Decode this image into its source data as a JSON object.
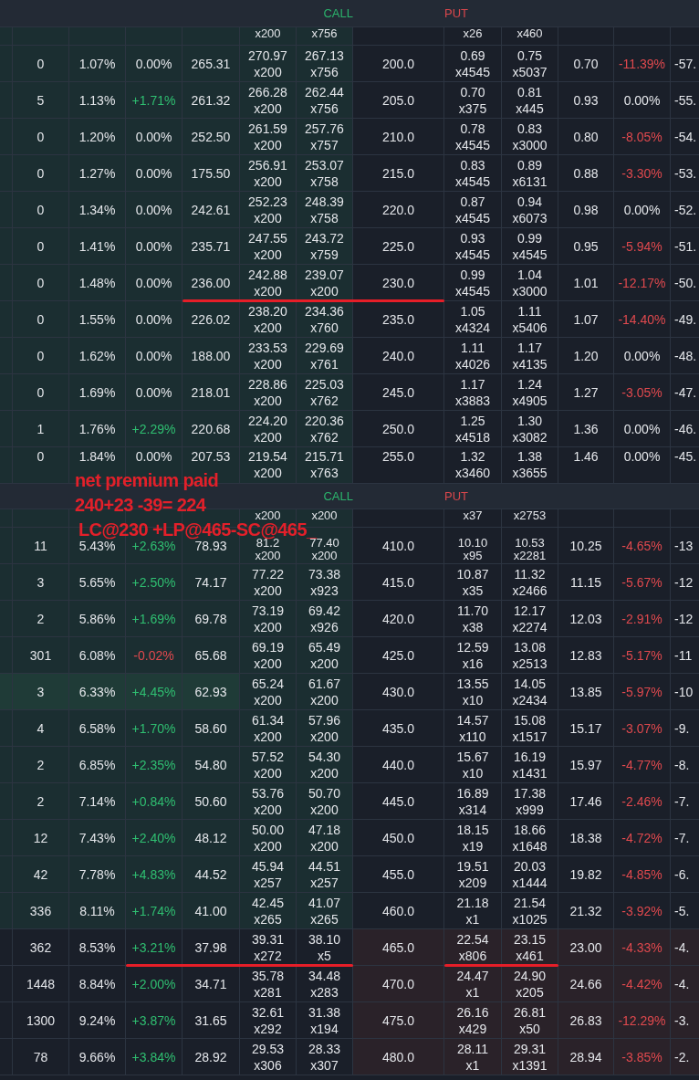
{
  "panels": [
    {
      "header": {
        "call": "CALL",
        "put": "PUT"
      },
      "rows": [
        {
          "kind": "cut",
          "highlighted": false,
          "call_itm": true,
          "put_itm": false,
          "call_quotes": [
            [
              "x200"
            ],
            [
              "x756"
            ]
          ],
          "put_quotes": [
            [
              "x26"
            ],
            [
              "x460"
            ]
          ]
        },
        {
          "kind": "full",
          "strike": "200.0",
          "highlighted": false,
          "call_itm": true,
          "put_itm": false,
          "call_cells": [
            "0",
            "1.07%",
            "265.31"
          ],
          "call_change": {
            "text": "0.00%",
            "color": "#e4e6ea"
          },
          "call_quotes": [
            [
              "270.97",
              "x200"
            ],
            [
              "267.13",
              "x756"
            ]
          ],
          "put_quotes": [
            [
              "0.69",
              "x4545"
            ],
            [
              "0.75",
              "x5037"
            ]
          ],
          "put_change": {
            "text": "-11.39%",
            "color": "#e0494e"
          },
          "put_cells": [
            "0.70",
            "-57."
          ]
        },
        {
          "kind": "full",
          "strike": "205.0",
          "highlighted": false,
          "call_itm": true,
          "put_itm": false,
          "call_cells": [
            "5",
            "1.13%",
            "261.32"
          ],
          "call_change": {
            "text": "+1.71%",
            "color": "#2fbf71"
          },
          "call_quotes": [
            [
              "266.28",
              "x200"
            ],
            [
              "262.44",
              "x756"
            ]
          ],
          "put_quotes": [
            [
              "0.70",
              "x375"
            ],
            [
              "0.81",
              "x445"
            ]
          ],
          "put_change": {
            "text": "0.00%",
            "color": "#e4e6ea"
          },
          "put_cells": [
            "0.93",
            "-55."
          ]
        },
        {
          "kind": "full",
          "strike": "210.0",
          "highlighted": false,
          "call_itm": true,
          "put_itm": false,
          "call_cells": [
            "0",
            "1.20%",
            "252.50"
          ],
          "call_change": {
            "text": "0.00%",
            "color": "#e4e6ea"
          },
          "call_quotes": [
            [
              "261.59",
              "x200"
            ],
            [
              "257.76",
              "x757"
            ]
          ],
          "put_quotes": [
            [
              "0.78",
              "x4545"
            ],
            [
              "0.83",
              "x3000"
            ]
          ],
          "put_change": {
            "text": "-8.05%",
            "color": "#e0494e"
          },
          "put_cells": [
            "0.80",
            "-54."
          ]
        },
        {
          "kind": "full",
          "strike": "215.0",
          "highlighted": false,
          "call_itm": true,
          "put_itm": false,
          "call_cells": [
            "0",
            "1.27%",
            "175.50"
          ],
          "call_change": {
            "text": "0.00%",
            "color": "#e4e6ea"
          },
          "call_quotes": [
            [
              "256.91",
              "x200"
            ],
            [
              "253.07",
              "x758"
            ]
          ],
          "put_quotes": [
            [
              "0.83",
              "x4545"
            ],
            [
              "0.89",
              "x6131"
            ]
          ],
          "put_change": {
            "text": "-3.30%",
            "color": "#e0494e"
          },
          "put_cells": [
            "0.88",
            "-53."
          ]
        },
        {
          "kind": "full",
          "strike": "220.0",
          "highlighted": false,
          "call_itm": true,
          "put_itm": false,
          "call_cells": [
            "0",
            "1.34%",
            "242.61"
          ],
          "call_change": {
            "text": "0.00%",
            "color": "#e4e6ea"
          },
          "call_quotes": [
            [
              "252.23",
              "x200"
            ],
            [
              "248.39",
              "x758"
            ]
          ],
          "put_quotes": [
            [
              "0.87",
              "x4545"
            ],
            [
              "0.94",
              "x6073"
            ]
          ],
          "put_change": {
            "text": "0.00%",
            "color": "#e4e6ea"
          },
          "put_cells": [
            "0.98",
            "-52."
          ]
        },
        {
          "kind": "full",
          "strike": "225.0",
          "highlighted": false,
          "call_itm": true,
          "put_itm": false,
          "call_cells": [
            "0",
            "1.41%",
            "235.71"
          ],
          "call_change": {
            "text": "0.00%",
            "color": "#e4e6ea"
          },
          "call_quotes": [
            [
              "247.55",
              "x200"
            ],
            [
              "243.72",
              "x759"
            ]
          ],
          "put_quotes": [
            [
              "0.93",
              "x4545"
            ],
            [
              "0.99",
              "x4545"
            ]
          ],
          "put_change": {
            "text": "-5.94%",
            "color": "#e0494e"
          },
          "put_cells": [
            "0.95",
            "-51."
          ]
        },
        {
          "kind": "full",
          "strike": "230.0",
          "highlighted": false,
          "call_itm": true,
          "put_itm": false,
          "call_cells": [
            "0",
            "1.48%",
            "236.00"
          ],
          "call_change": {
            "text": "0.00%",
            "color": "#e4e6ea"
          },
          "call_quotes": [
            [
              "242.88",
              "x200"
            ],
            [
              "239.07",
              "x200"
            ]
          ],
          "put_quotes": [
            [
              "0.99",
              "x4545"
            ],
            [
              "1.04",
              "x3000"
            ]
          ],
          "put_change": {
            "text": "-12.17%",
            "color": "#e0494e"
          },
          "put_cells": [
            "1.01",
            "-50."
          ],
          "underline_call": true,
          "underline_change": false,
          "underline_strike": true,
          "underline_put": false
        },
        {
          "kind": "full",
          "strike": "235.0",
          "highlighted": false,
          "call_itm": true,
          "put_itm": false,
          "call_cells": [
            "0",
            "1.55%",
            "226.02"
          ],
          "call_change": {
            "text": "0.00%",
            "color": "#e4e6ea"
          },
          "call_quotes": [
            [
              "238.20",
              "x200"
            ],
            [
              "234.36",
              "x760"
            ]
          ],
          "put_quotes": [
            [
              "1.05",
              "x4324"
            ],
            [
              "1.11",
              "x5406"
            ]
          ],
          "put_change": {
            "text": "-14.40%",
            "color": "#e0494e"
          },
          "put_cells": [
            "1.07",
            "-49."
          ]
        },
        {
          "kind": "full",
          "strike": "240.0",
          "highlighted": false,
          "call_itm": true,
          "put_itm": false,
          "call_cells": [
            "0",
            "1.62%",
            "188.00"
          ],
          "call_change": {
            "text": "0.00%",
            "color": "#e4e6ea"
          },
          "call_quotes": [
            [
              "233.53",
              "x200"
            ],
            [
              "229.69",
              "x761"
            ]
          ],
          "put_quotes": [
            [
              "1.11",
              "x4026"
            ],
            [
              "1.17",
              "x4135"
            ]
          ],
          "put_change": {
            "text": "0.00%",
            "color": "#e4e6ea"
          },
          "put_cells": [
            "1.20",
            "-48."
          ]
        },
        {
          "kind": "full",
          "strike": "245.0",
          "highlighted": false,
          "call_itm": true,
          "put_itm": false,
          "call_cells": [
            "0",
            "1.69%",
            "218.01"
          ],
          "call_change": {
            "text": "0.00%",
            "color": "#e4e6ea"
          },
          "call_quotes": [
            [
              "228.86",
              "x200"
            ],
            [
              "225.03",
              "x762"
            ]
          ],
          "put_quotes": [
            [
              "1.17",
              "x3883"
            ],
            [
              "1.24",
              "x4905"
            ]
          ],
          "put_change": {
            "text": "-3.05%",
            "color": "#e0494e"
          },
          "put_cells": [
            "1.27",
            "-47."
          ]
        },
        {
          "kind": "full",
          "strike": "250.0",
          "highlighted": false,
          "call_itm": true,
          "put_itm": false,
          "call_cells": [
            "1",
            "1.76%",
            "220.68"
          ],
          "call_change": {
            "text": "+2.29%",
            "color": "#2fbf71"
          },
          "call_quotes": [
            [
              "224.20",
              "x200"
            ],
            [
              "220.36",
              "x762"
            ]
          ],
          "put_quotes": [
            [
              "1.25",
              "x4518"
            ],
            [
              "1.30",
              "x3082"
            ]
          ],
          "put_change": {
            "text": "0.00%",
            "color": "#e4e6ea"
          },
          "put_cells": [
            "1.36",
            "-46."
          ]
        },
        {
          "kind": "full",
          "strike": "255.0",
          "highlighted": false,
          "call_itm": true,
          "put_itm": false,
          "call_cells": [
            "0",
            "1.84%",
            "207.53"
          ],
          "call_change": {
            "text": "0.00%",
            "color": "#e4e6ea"
          },
          "call_quotes": [
            [
              "219.54",
              "x200"
            ],
            [
              "215.71",
              "x763"
            ]
          ],
          "put_quotes": [
            [
              "1.32",
              "x3460"
            ],
            [
              "1.38",
              "x3655"
            ]
          ],
          "put_change": {
            "text": "0.00%",
            "color": "#e4e6ea"
          },
          "put_cells": [
            "1.46",
            "-45."
          ]
        }
      ]
    },
    {
      "header": {
        "call": "CALL",
        "put": "PUT"
      },
      "rows": [
        {
          "kind": "cut",
          "highlighted": false,
          "call_itm": true,
          "put_itm": false,
          "call_quotes": [
            [
              "x200"
            ],
            [
              "x200"
            ]
          ],
          "put_quotes": [
            [
              "x37"
            ],
            [
              "x2753"
            ]
          ]
        },
        {
          "kind": "full",
          "strike": "410.0",
          "highlighted": false,
          "call_itm": true,
          "put_itm": false,
          "call_cells": [
            "11",
            "5.43%",
            "78.93"
          ],
          "call_change": {
            "text": "+2.63%",
            "color": "#2fbf71"
          },
          "call_quotes": [
            [
              "81.2",
              "x200"
            ],
            [
              "77.40",
              "x200"
            ]
          ],
          "put_quotes": [
            [
              "10.10",
              "x95"
            ],
            [
              "10.53",
              "x2281"
            ]
          ],
          "put_change": {
            "text": "-4.65%",
            "color": "#e0494e"
          },
          "put_cells": [
            "10.25",
            "-13"
          ]
        },
        {
          "kind": "full",
          "strike": "415.0",
          "highlighted": false,
          "call_itm": true,
          "put_itm": false,
          "call_cells": [
            "3",
            "5.65%",
            "74.17"
          ],
          "call_change": {
            "text": "+2.50%",
            "color": "#2fbf71"
          },
          "call_quotes": [
            [
              "77.22",
              "x200"
            ],
            [
              "73.38",
              "x923"
            ]
          ],
          "put_quotes": [
            [
              "10.87",
              "x35"
            ],
            [
              "11.32",
              "x2466"
            ]
          ],
          "put_change": {
            "text": "-5.67%",
            "color": "#e0494e"
          },
          "put_cells": [
            "11.15",
            "-12"
          ]
        },
        {
          "kind": "full",
          "strike": "420.0",
          "highlighted": false,
          "call_itm": true,
          "put_itm": false,
          "call_cells": [
            "2",
            "5.86%",
            "69.78"
          ],
          "call_change": {
            "text": "+1.69%",
            "color": "#2fbf71"
          },
          "call_quotes": [
            [
              "73.19",
              "x200"
            ],
            [
              "69.42",
              "x926"
            ]
          ],
          "put_quotes": [
            [
              "11.70",
              "x38"
            ],
            [
              "12.17",
              "x2274"
            ]
          ],
          "put_change": {
            "text": "-2.91%",
            "color": "#e0494e"
          },
          "put_cells": [
            "12.03",
            "-12"
          ]
        },
        {
          "kind": "full",
          "strike": "425.0",
          "highlighted": false,
          "call_itm": true,
          "put_itm": false,
          "call_cells": [
            "301",
            "6.08%",
            "65.68"
          ],
          "call_change": {
            "text": "-0.02%",
            "color": "#e0494e"
          },
          "call_quotes": [
            [
              "69.19",
              "x200"
            ],
            [
              "65.49",
              "x200"
            ]
          ],
          "put_quotes": [
            [
              "12.59",
              "x16"
            ],
            [
              "13.08",
              "x2513"
            ]
          ],
          "put_change": {
            "text": "-5.17%",
            "color": "#e0494e"
          },
          "put_cells": [
            "12.83",
            "-11"
          ]
        },
        {
          "kind": "full",
          "strike": "430.0",
          "highlighted": true,
          "call_itm": true,
          "put_itm": false,
          "call_cells": [
            "3",
            "6.33%",
            "62.93"
          ],
          "call_change": {
            "text": "+4.45%",
            "color": "#2fbf71"
          },
          "call_quotes": [
            [
              "65.24",
              "x200"
            ],
            [
              "61.67",
              "x200"
            ]
          ],
          "put_quotes": [
            [
              "13.55",
              "x10"
            ],
            [
              "14.05",
              "x2434"
            ]
          ],
          "put_change": {
            "text": "-5.97%",
            "color": "#e0494e"
          },
          "put_cells": [
            "13.85",
            "-10"
          ]
        },
        {
          "kind": "full",
          "strike": "435.0",
          "highlighted": false,
          "call_itm": true,
          "put_itm": false,
          "call_cells": [
            "4",
            "6.58%",
            "58.60"
          ],
          "call_change": {
            "text": "+1.70%",
            "color": "#2fbf71"
          },
          "call_quotes": [
            [
              "61.34",
              "x200"
            ],
            [
              "57.96",
              "x200"
            ]
          ],
          "put_quotes": [
            [
              "14.57",
              "x110"
            ],
            [
              "15.08",
              "x1517"
            ]
          ],
          "put_change": {
            "text": "-3.07%",
            "color": "#e0494e"
          },
          "put_cells": [
            "15.17",
            "-9."
          ]
        },
        {
          "kind": "full",
          "strike": "440.0",
          "highlighted": false,
          "call_itm": true,
          "put_itm": false,
          "call_cells": [
            "2",
            "6.85%",
            "54.80"
          ],
          "call_change": {
            "text": "+2.35%",
            "color": "#2fbf71"
          },
          "call_quotes": [
            [
              "57.52",
              "x200"
            ],
            [
              "54.30",
              "x200"
            ]
          ],
          "put_quotes": [
            [
              "15.67",
              "x10"
            ],
            [
              "16.19",
              "x1431"
            ]
          ],
          "put_change": {
            "text": "-4.77%",
            "color": "#e0494e"
          },
          "put_cells": [
            "15.97",
            "-8."
          ]
        },
        {
          "kind": "full",
          "strike": "445.0",
          "highlighted": false,
          "call_itm": true,
          "put_itm": false,
          "call_cells": [
            "2",
            "7.14%",
            "50.60"
          ],
          "call_change": {
            "text": "+0.84%",
            "color": "#2fbf71"
          },
          "call_quotes": [
            [
              "53.76",
              "x200"
            ],
            [
              "50.70",
              "x200"
            ]
          ],
          "put_quotes": [
            [
              "16.89",
              "x314"
            ],
            [
              "17.38",
              "x999"
            ]
          ],
          "put_change": {
            "text": "-2.46%",
            "color": "#e0494e"
          },
          "put_cells": [
            "17.46",
            "-7."
          ]
        },
        {
          "kind": "full",
          "strike": "450.0",
          "highlighted": false,
          "call_itm": true,
          "put_itm": false,
          "call_cells": [
            "12",
            "7.43%",
            "48.12"
          ],
          "call_change": {
            "text": "+2.40%",
            "color": "#2fbf71"
          },
          "call_quotes": [
            [
              "50.00",
              "x200"
            ],
            [
              "47.18",
              "x200"
            ]
          ],
          "put_quotes": [
            [
              "18.15",
              "x19"
            ],
            [
              "18.66",
              "x1648"
            ]
          ],
          "put_change": {
            "text": "-4.72%",
            "color": "#e0494e"
          },
          "put_cells": [
            "18.38",
            "-7."
          ]
        },
        {
          "kind": "full",
          "strike": "455.0",
          "highlighted": false,
          "call_itm": true,
          "put_itm": false,
          "call_cells": [
            "42",
            "7.78%",
            "44.52"
          ],
          "call_change": {
            "text": "+4.83%",
            "color": "#2fbf71"
          },
          "call_quotes": [
            [
              "45.94",
              "x257"
            ],
            [
              "44.51",
              "x257"
            ]
          ],
          "put_quotes": [
            [
              "19.51",
              "x209"
            ],
            [
              "20.03",
              "x1444"
            ]
          ],
          "put_change": {
            "text": "-4.85%",
            "color": "#e0494e"
          },
          "put_cells": [
            "19.82",
            "-6."
          ]
        },
        {
          "kind": "full",
          "strike": "460.0",
          "highlighted": false,
          "call_itm": true,
          "put_itm": false,
          "call_cells": [
            "336",
            "8.11%",
            "41.00"
          ],
          "call_change": {
            "text": "+1.74%",
            "color": "#2fbf71"
          },
          "call_quotes": [
            [
              "42.45",
              "x265"
            ],
            [
              "41.07",
              "x265"
            ]
          ],
          "put_quotes": [
            [
              "21.18",
              "x1"
            ],
            [
              "21.54",
              "x1025"
            ]
          ],
          "put_change": {
            "text": "-3.92%",
            "color": "#e0494e"
          },
          "put_cells": [
            "21.32",
            "-5."
          ]
        },
        {
          "kind": "full",
          "strike": "465.0",
          "highlighted": false,
          "call_itm": false,
          "put_itm": true,
          "call_cells": [
            "362",
            "8.53%",
            "37.98"
          ],
          "call_change": {
            "text": "+3.21%",
            "color": "#2fbf71"
          },
          "call_quotes": [
            [
              "39.31",
              "x272"
            ],
            [
              "38.10",
              "x5"
            ]
          ],
          "put_quotes": [
            [
              "22.54",
              "x806"
            ],
            [
              "23.15",
              "x461"
            ]
          ],
          "put_change": {
            "text": "-4.33%",
            "color": "#e0494e"
          },
          "put_cells": [
            "23.00",
            "-4."
          ],
          "underline_call": true,
          "underline_change": true,
          "underline_strike": false,
          "underline_put": true
        },
        {
          "kind": "full",
          "strike": "470.0",
          "highlighted": false,
          "call_itm": false,
          "put_itm": true,
          "call_cells": [
            "1448",
            "8.84%",
            "34.71"
          ],
          "call_change": {
            "text": "+2.00%",
            "color": "#2fbf71"
          },
          "call_quotes": [
            [
              "35.78",
              "x281"
            ],
            [
              "34.48",
              "x283"
            ]
          ],
          "put_quotes": [
            [
              "24.47",
              "x1"
            ],
            [
              "24.90",
              "x205"
            ]
          ],
          "put_change": {
            "text": "-4.42%",
            "color": "#e0494e"
          },
          "put_cells": [
            "24.66",
            "-4."
          ]
        },
        {
          "kind": "full",
          "strike": "475.0",
          "highlighted": false,
          "call_itm": false,
          "put_itm": true,
          "call_cells": [
            "1300",
            "9.24%",
            "31.65"
          ],
          "call_change": {
            "text": "+3.87%",
            "color": "#2fbf71"
          },
          "call_quotes": [
            [
              "32.61",
              "x292"
            ],
            [
              "31.38",
              "x194"
            ]
          ],
          "put_quotes": [
            [
              "26.16",
              "x429"
            ],
            [
              "26.81",
              "x50"
            ]
          ],
          "put_change": {
            "text": "-12.29%",
            "color": "#e0494e"
          },
          "put_cells": [
            "26.83",
            "-3."
          ]
        },
        {
          "kind": "full",
          "strike": "480.0",
          "highlighted": false,
          "call_itm": false,
          "put_itm": true,
          "call_cells": [
            "78",
            "9.66%",
            "28.92"
          ],
          "call_change": {
            "text": "+3.84%",
            "color": "#2fbf71"
          },
          "call_quotes": [
            [
              "29.53",
              "x306"
            ],
            [
              "28.33",
              "x307"
            ]
          ],
          "put_quotes": [
            [
              "28.11",
              "x1"
            ],
            [
              "29.31",
              "x1391"
            ]
          ],
          "put_change": {
            "text": "-3.85%",
            "color": "#e0494e"
          },
          "put_cells": [
            "28.94",
            "-2."
          ]
        }
      ]
    }
  ],
  "annotation": {
    "lines": [
      "net premium paid",
      "240+23 -39= 224",
      "LC@230 +LP@465-SC@465_"
    ]
  }
}
